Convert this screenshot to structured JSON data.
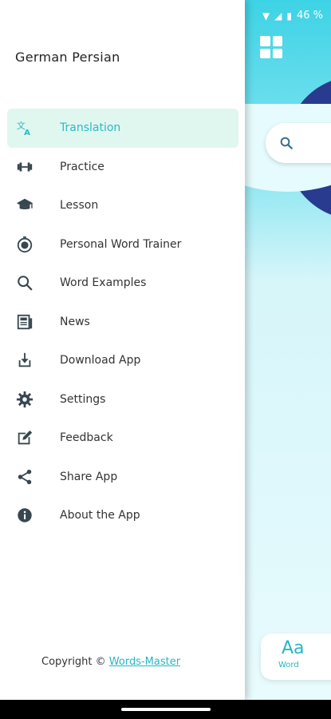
{
  "status_bar": {
    "battery": "46 %"
  },
  "drawer": {
    "title": "German Persian",
    "items": [
      {
        "label": "Translation",
        "icon": "translate-icon",
        "active": true
      },
      {
        "label": "Practice",
        "icon": "dumbbell-icon"
      },
      {
        "label": "Lesson",
        "icon": "graduation-cap-icon"
      },
      {
        "label": "Personal Word Trainer",
        "icon": "timer-icon"
      },
      {
        "label": "Word Examples",
        "icon": "search-icon"
      },
      {
        "label": "News",
        "icon": "newspaper-icon"
      },
      {
        "label": "Download App",
        "icon": "download-icon"
      },
      {
        "label": "Settings",
        "icon": "gear-icon"
      },
      {
        "label": "Feedback",
        "icon": "feedback-edit-icon"
      },
      {
        "label": "Share App",
        "icon": "share-icon"
      },
      {
        "label": "About the App",
        "icon": "info-icon"
      }
    ],
    "footer_prefix": "Copyright © ",
    "footer_link": "Words-Master"
  },
  "app": {
    "word_card_glyph": "Aa",
    "word_card_label": "Word"
  },
  "colors": {
    "accent": "#2bbac6",
    "active_bg": "#e0f7ef",
    "dark_blue": "#283b8f"
  }
}
